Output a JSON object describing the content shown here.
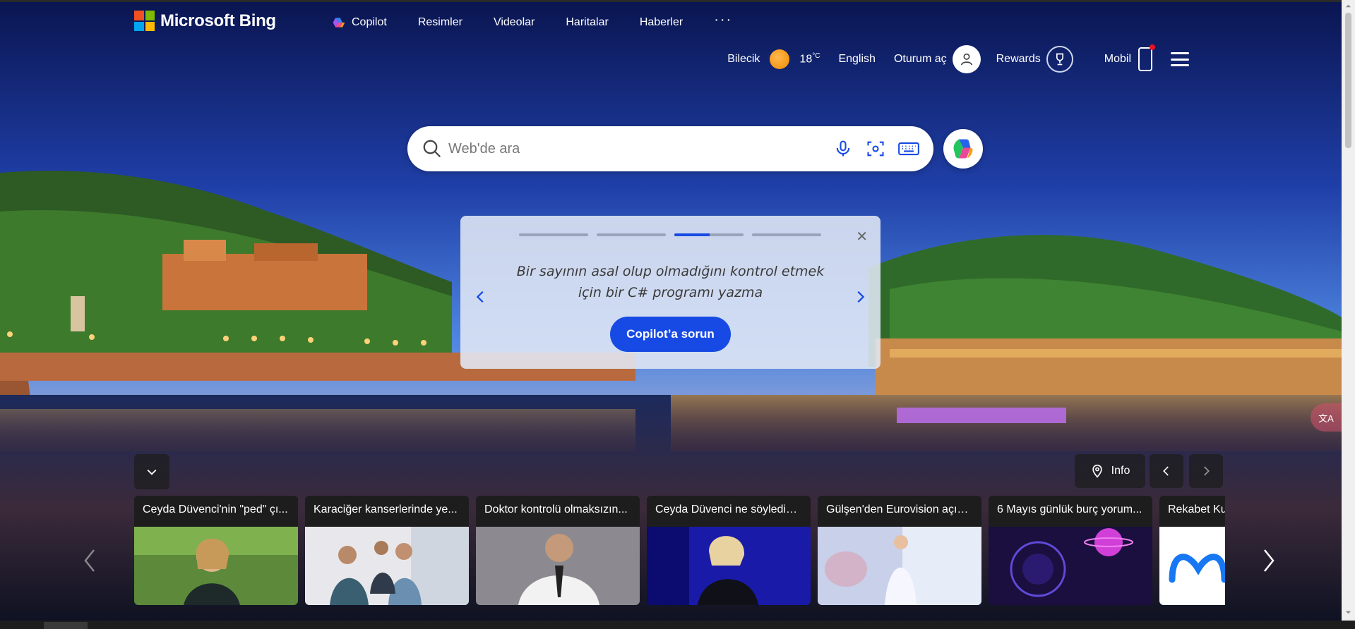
{
  "brand": {
    "name": "Microsoft Bing"
  },
  "nav": {
    "copilot": "Copilot",
    "images": "Resimler",
    "videos": "Videolar",
    "maps": "Haritalar",
    "news": "Haberler",
    "more": "···"
  },
  "header": {
    "location": "Bilecik",
    "temperature": "18",
    "temp_unit": "°C",
    "language": "English",
    "sign_in": "Oturum aç",
    "rewards": "Rewards",
    "mobile": "Mobil"
  },
  "search": {
    "placeholder": "Web'de ara"
  },
  "prompt_card": {
    "text": "Bir sayının asal olup olmadığını kontrol etmek için bir C# programı yazma",
    "button": "Copilot’a sorun",
    "progress": {
      "total": 4,
      "active_index": 2,
      "active_fraction": 0.6
    }
  },
  "image_info": {
    "label": "Info"
  },
  "news": [
    {
      "title": "Ceyda Düvenci'nin \"ped\" çı..."
    },
    {
      "title": "Karaciğer kanserlerinde ye..."
    },
    {
      "title": "Doktor kontrolü olmaksızın..."
    },
    {
      "title": "Ceyda Düvenci ne söyledi? ..."
    },
    {
      "title": "Gülşen'den Eurovision açıkl..."
    },
    {
      "title": "6 Mayıs günlük burç yorum..."
    },
    {
      "title": "Rekabet Ku"
    }
  ],
  "colors": {
    "accent": "#174ae4",
    "sky_top": "#0b1a5a",
    "sky_bottom": "#3b6fd8"
  }
}
